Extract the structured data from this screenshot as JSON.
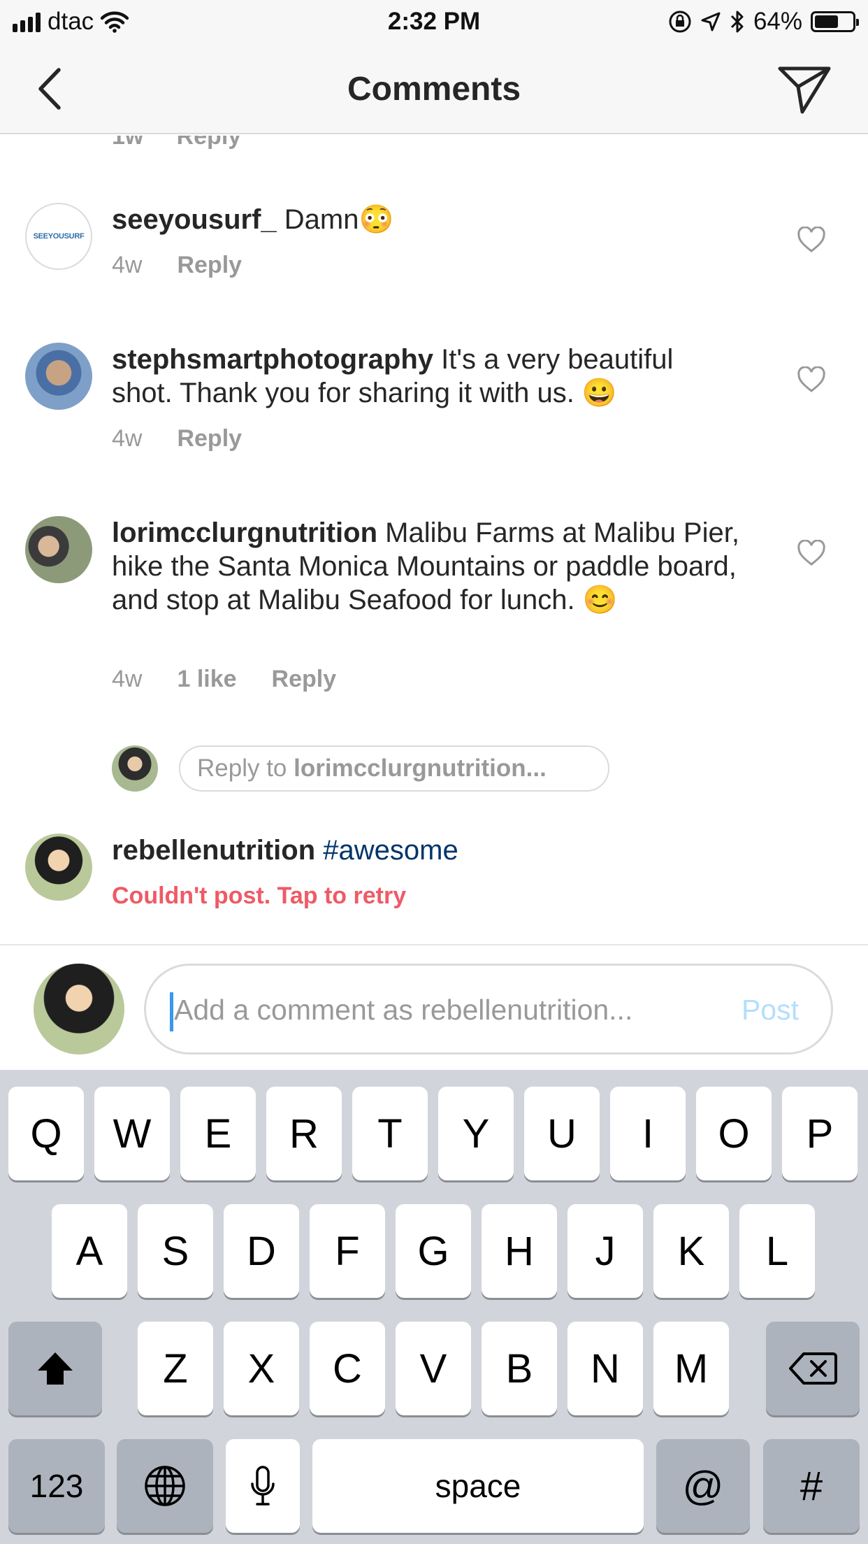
{
  "status_bar": {
    "carrier": "dtac",
    "time": "2:32 PM",
    "battery": "64%",
    "battery_level": 0.64
  },
  "header": {
    "title": "Comments"
  },
  "comments": [
    {
      "username": "seeyousurf_",
      "text": "Damn😳",
      "time": "4w",
      "reply_label": "Reply"
    },
    {
      "username": "stephsmartphotography",
      "text": "It's a very beautiful shot. Thank you for sharing it with us. 😀",
      "time": "4w",
      "reply_label": "Reply"
    },
    {
      "username": "lorimcclurgnutrition",
      "text": "Malibu Farms at Malibu Pier, hike the Santa Monica Mountains or paddle board, and stop at Malibu Seafood for lunch. 😊",
      "time": "4w",
      "likes": "1 like",
      "reply_label": "Reply",
      "reply_prompt": "Reply to ",
      "reply_prompt_user": "lorimcclurgnutrition..."
    },
    {
      "username": "rebellenutrition",
      "text": "#awesome",
      "error": "Couldn't post. Tap to retry"
    }
  ],
  "avatar_text": "SEEYOUSURF",
  "composer": {
    "placeholder": "Add a comment as rebellenutrition...",
    "post_label": "Post"
  },
  "keyboard": {
    "row1": [
      "Q",
      "W",
      "E",
      "R",
      "T",
      "Y",
      "U",
      "I",
      "O",
      "P"
    ],
    "row2": [
      "A",
      "S",
      "D",
      "F",
      "G",
      "H",
      "J",
      "K",
      "L"
    ],
    "row3": [
      "Z",
      "X",
      "C",
      "V",
      "B",
      "N",
      "M"
    ],
    "numbers_label": "123",
    "space_label": "space",
    "at_label": "@",
    "hash_label": "#"
  },
  "colors": {
    "error": "#ed4956",
    "hashtag": "#003569",
    "post_disabled": "#b2dffc",
    "caret": "#3897f0"
  }
}
